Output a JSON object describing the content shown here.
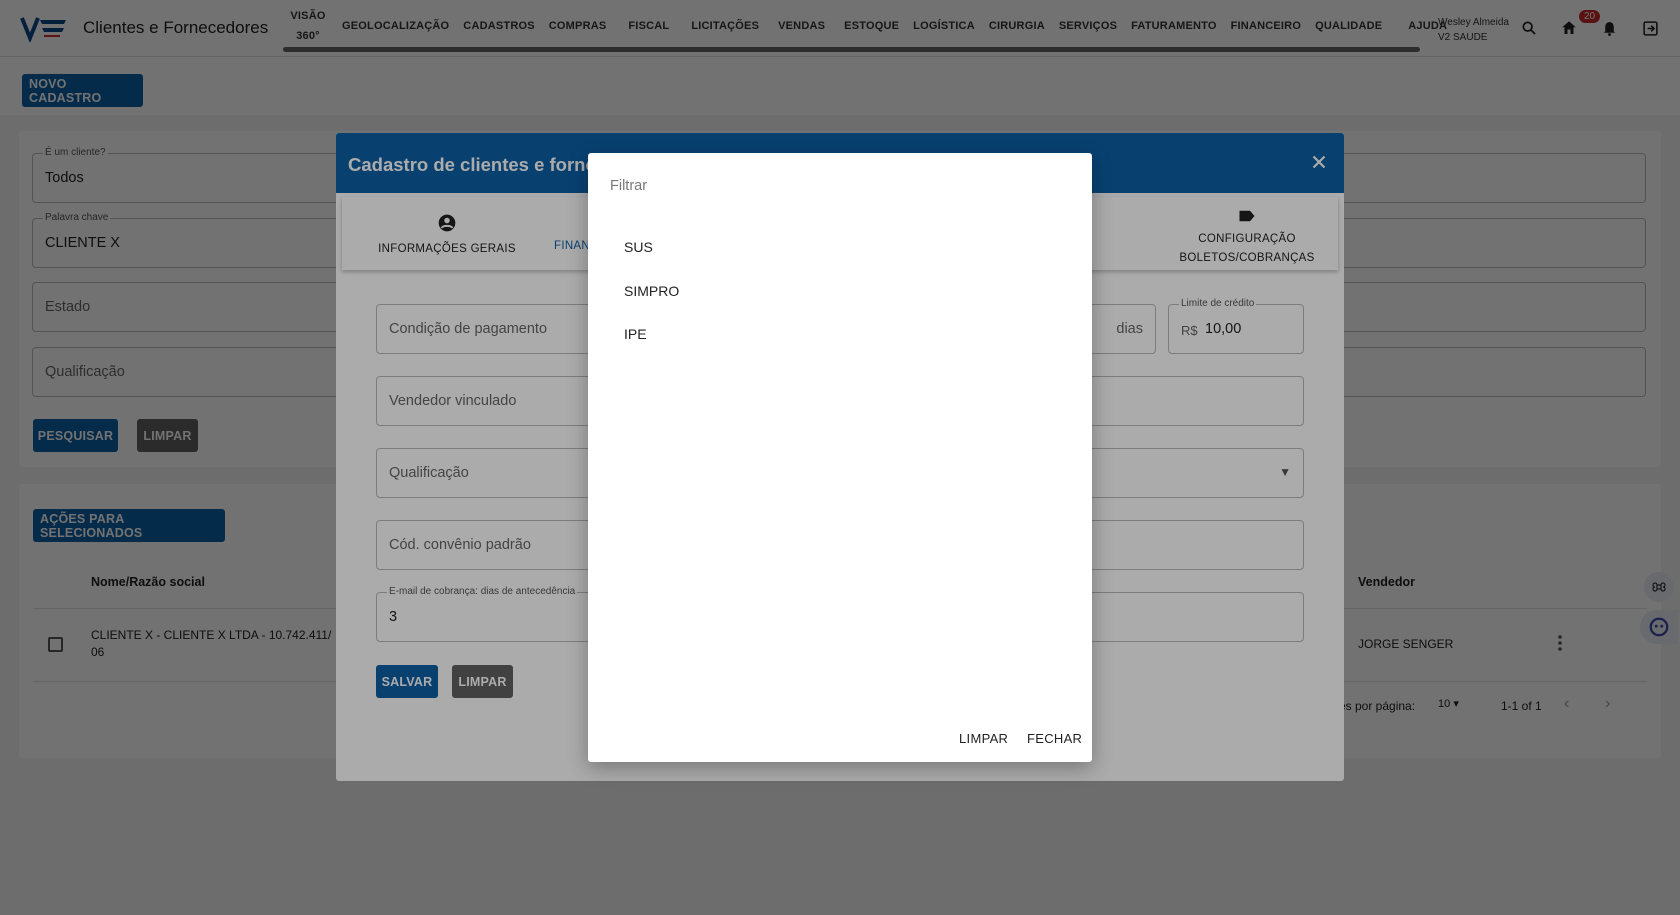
{
  "header": {
    "app_title": "Clientes e Fornecedores",
    "nav": [
      {
        "label": "VISÃO 360°"
      },
      {
        "label": "GEOLOCALIZAÇÃO"
      },
      {
        "label": "CADASTROS"
      },
      {
        "label": "COMPRAS"
      },
      {
        "label": "FISCAL"
      },
      {
        "label": "LICITAÇÕES"
      },
      {
        "label": "VENDAS"
      },
      {
        "label": "ESTOQUE"
      },
      {
        "label": "LOGÍSTICA"
      },
      {
        "label": "CIRURGIA"
      },
      {
        "label": "SERVIÇOS"
      },
      {
        "label": "FATURAMENTO"
      },
      {
        "label": "FINANCEIRO"
      },
      {
        "label": "QUALIDADE"
      },
      {
        "label": "AJUDA"
      }
    ],
    "user_name": "Wesley Almeida",
    "user_company": "V2 SAUDE",
    "notification_count": "20"
  },
  "page": {
    "new_button": "NOVO CADASTRO",
    "filters": {
      "is_client_label": "É um cliente?",
      "is_client_value": "Todos",
      "keyword_label": "Palavra chave",
      "keyword_value": "CLIENTE X",
      "state_placeholder": "Estado",
      "qualification_placeholder": "Qualificação",
      "search_button": "PESQUISAR",
      "clear_button": "LIMPAR"
    },
    "table": {
      "bulk_button": "AÇÕES PARA SELECIONADOS",
      "col_name": "Nome/Razão social",
      "col_seller": "Vendedor",
      "row_name_line1": "CLIENTE X - CLIENTE X LTDA - 10.742.411/",
      "row_name_line2": "06",
      "row_seller": "JORGE SENGER",
      "rows_per_page_label": "es por página:",
      "rows_per_page_value": "10",
      "range": "1-1 of 1"
    }
  },
  "modal": {
    "title": "Cadastro de clientes e fornec",
    "tabs": {
      "general": "INFORMAÇÕES GERAIS",
      "financial": "FINAN",
      "billing_line1": "CONFIGURAÇÃO",
      "billing_line2": "BOLETOS/COBRANÇAS"
    },
    "fields": {
      "payment_condition": "Condição de pagamento",
      "days_suffix": "dias",
      "credit_limit_label": "Limite de crédito",
      "credit_currency": "R$",
      "credit_value": "10,00",
      "linked_seller": "Vendedor vinculado",
      "qualification": "Qualificação",
      "default_agreement": "Cód. convênio padrão",
      "email_days_label": "E-mail de cobrança: dias de antecedência",
      "email_days_value": "3"
    },
    "save_button": "SALVAR",
    "clear_button": "LIMPAR"
  },
  "dialog": {
    "filter_placeholder": "Filtrar",
    "options": [
      "SUS",
      "SIMPRO",
      "IPE"
    ],
    "clear_button": "LIMPAR",
    "close_button": "FECHAR"
  },
  "colors": {
    "primary": "#0d61a8",
    "secondary_button": "#616161",
    "badge": "#c62828"
  },
  "icons": [
    "search-icon",
    "home-icon",
    "bell-icon",
    "logout-icon",
    "close-icon",
    "account-circle-icon",
    "label-icon",
    "chevron-down-icon",
    "more-vert-icon",
    "chevron-left-icon",
    "chevron-right-icon",
    "command-icon",
    "assistant-icon"
  ]
}
